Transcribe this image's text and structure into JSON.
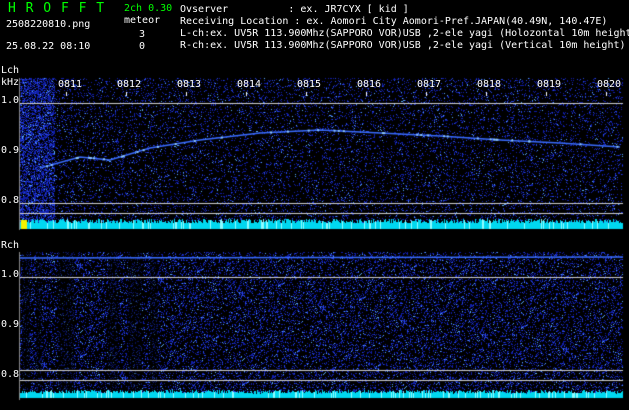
{
  "header": {
    "app_title": "H R O F F T",
    "mode": "2ch 0.30",
    "filename": "2508220810.png",
    "meteor_label": "meteor",
    "lch_count": "3",
    "rch_count": "0",
    "datetime": "25.08.22 08:10",
    "observer_line": "Ovserver          : ex. JR7CYX [ kid ]",
    "location_line": "Receiving Location : ex. Aomori City Aomori-Pref.JAPAN(40.49N, 140.47E)",
    "lch_line": "L-ch:ex. UV5R 113.900Mhz(SAPPORO VOR)USB ,2-ele yagi (Holozontal 10m height)",
    "rch_line": "R-ch:ex. UV5R 113.900Mhz(SAPPORO VOR)USB ,2-ele yagi (Vertical 10m height)"
  },
  "lch_panel": {
    "channel_label": "Lch",
    "unit_label": "kHz",
    "time_ticks": [
      "0811",
      "0812",
      "0813",
      "0814",
      "0815",
      "0816",
      "0817",
      "0818",
      "0819",
      "0820"
    ],
    "freq_ticks": [
      "1.0",
      "0.9",
      "0.8"
    ]
  },
  "rch_panel": {
    "channel_label": "Rch",
    "freq_ticks": [
      "1.0",
      "0.9",
      "0.8"
    ]
  },
  "colors": {
    "title": "#00ff00",
    "text": "#ffffff",
    "noise": "#1a2cc8",
    "bright": "#6ab8ff",
    "signal_band": "#00e8ff",
    "grid": "#cfcfcf"
  }
}
